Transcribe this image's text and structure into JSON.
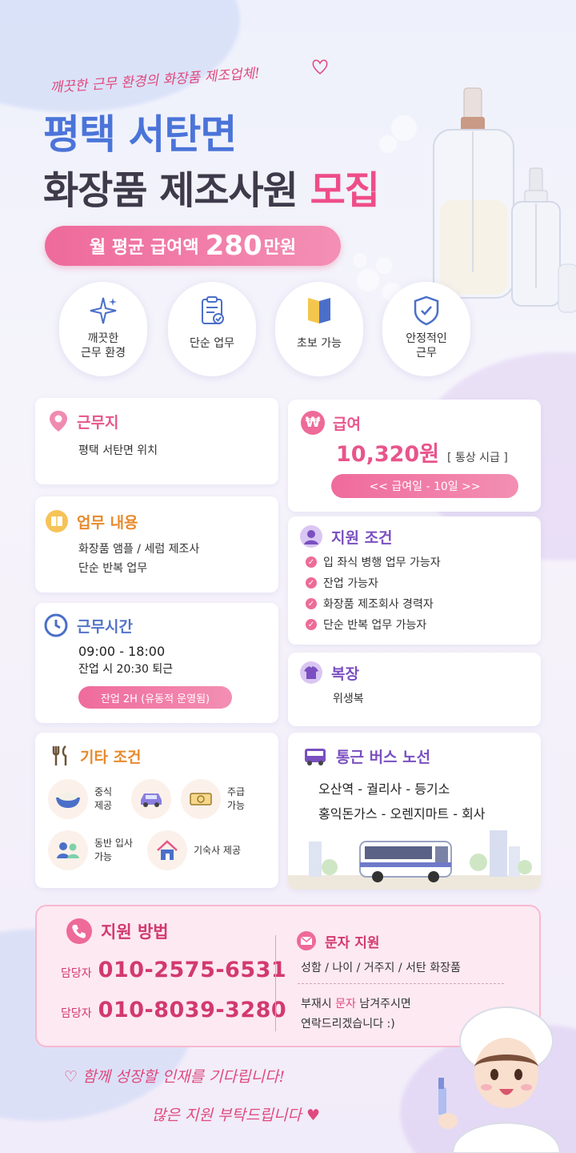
{
  "header": {
    "tagline": "깨끗한 근무 환경의 화장품 제조업체!",
    "title_line1": "평택 서탄면",
    "title_line2_a": "화장품 제조사원",
    "title_line2_b": "모집",
    "salary_prefix": "월 평균 급여액",
    "salary_amount": "280",
    "salary_suffix": "만원"
  },
  "features": [
    {
      "label": "깨끗한\n근무 환경",
      "icon": "sparkle-icon"
    },
    {
      "label": "단순 업무",
      "icon": "clipboard-icon"
    },
    {
      "label": "초보 가능",
      "icon": "book-icon"
    },
    {
      "label": "안정적인\n근무",
      "icon": "shield-check-icon"
    }
  ],
  "location": {
    "title": "근무지",
    "text": "평택 서탄면 위치"
  },
  "pay": {
    "title": "급여",
    "wage": "10,320원",
    "wage_note": "[ 통상 시급 ]",
    "payday": "<< 급여일 - 10일 >>"
  },
  "duties": {
    "title": "업무 내용",
    "line1": "화장품 앰플 / 세럼 제조사",
    "line2": "단순 반복 업무"
  },
  "requirements": {
    "title": "지원 조건",
    "items": [
      "입 좌식 병행 업무 가능자",
      "잔업 가능자",
      "화장품 제조회사 경력자",
      "단순 반복 업무 가능자"
    ]
  },
  "hours": {
    "title": "근무시간",
    "line1": "09:00 - 18:00",
    "line2": "잔업 시 20:30 퇴근",
    "overtime": "잔업 2H (유동적 운영됨)"
  },
  "uniform": {
    "title": "복장",
    "text": "위생복"
  },
  "etc": {
    "title": "기타 조건",
    "items": [
      {
        "label": "중식\n제공",
        "icon": "meal-bowl-icon"
      },
      {
        "label": "",
        "icon": "car-icon"
      },
      {
        "label": "주급\n가능",
        "icon": "money-icon"
      },
      {
        "label": "동반 입사\n가능",
        "icon": "people-icon"
      },
      {
        "label": "기숙사 제공",
        "icon": "house-icon"
      }
    ]
  },
  "bus": {
    "title": "통근 버스 노선",
    "route1": "오산역 - 궐리사 - 등기소",
    "route2": "홍익돈가스 - 오렌지마트 - 회사"
  },
  "apply": {
    "title": "지원 방법",
    "contact_label": "담당자",
    "phone1": "010-2575-6531",
    "phone2": "010-8039-3280",
    "sms_title": "문자 지원",
    "sms_format": "성함 / 나이 / 거주지 / 서탄 화장품",
    "absent_a": "부재시 ",
    "absent_b": "문자",
    "absent_c": " 남겨주시면",
    "absent_line2": "연락드리겠습니다 :)"
  },
  "closing": {
    "line1": "함께 성장할 인재를 기다립니다!",
    "line2": "많은 지원 부탁드립니다"
  },
  "colors": {
    "pink": "#e8558b",
    "blue": "#4b74d9",
    "dark": "#3f3a4a"
  }
}
